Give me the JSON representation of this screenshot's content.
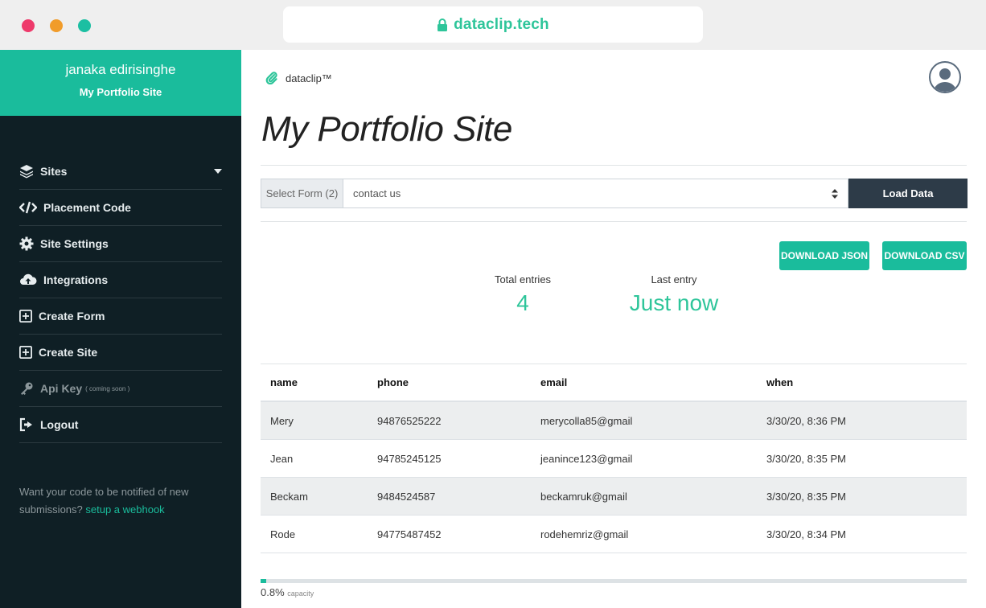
{
  "browser": {
    "url": "dataclip.tech"
  },
  "sidebar": {
    "user_name": "janaka edirisinghe",
    "site_name": "My Portfolio Site",
    "items": [
      {
        "label": "Sites",
        "icon": "layers-icon"
      },
      {
        "label": "Placement Code",
        "icon": "code-icon"
      },
      {
        "label": "Site Settings",
        "icon": "gear-icon"
      },
      {
        "label": "Integrations",
        "icon": "cloud-upload-icon"
      },
      {
        "label": "Create Form",
        "icon": "plus-square-icon"
      },
      {
        "label": "Create Site",
        "icon": "plus-square-icon"
      },
      {
        "label": "Api Key",
        "sub": "( coming soon )",
        "icon": "key-icon"
      },
      {
        "label": "Logout",
        "icon": "sign-out-icon"
      }
    ],
    "webhook_text": "Want your code to be notified of new submissions?",
    "webhook_link": "setup a webhook"
  },
  "main": {
    "brand": "dataclip™",
    "title": "My Portfolio Site",
    "form_label": "Select Form (2)",
    "form_selected": "contact us",
    "load_button": "Load Data",
    "download_json": "DOWNLOAD JSON",
    "download_csv": "DOWNLOAD CSV",
    "stats": {
      "total_label": "Total entries",
      "total_value": "4",
      "last_label": "Last entry",
      "last_value": "Just now"
    },
    "table": {
      "headers": [
        "name",
        "phone",
        "email",
        "when"
      ],
      "rows": [
        [
          "Mery",
          "94876525222",
          "merycolla85@gmail",
          "3/30/20, 8:36 PM"
        ],
        [
          "Jean",
          "94785245125",
          "jeanince123@gmail",
          "3/30/20, 8:35 PM"
        ],
        [
          "Beckam",
          "9484524587",
          "beckamruk@gmail",
          "3/30/20, 8:35 PM"
        ],
        [
          "Rode",
          "94775487452",
          "rodehemriz@gmail",
          "3/30/20, 8:34 PM"
        ]
      ]
    },
    "capacity": {
      "value": "0.8%",
      "label": "capacity",
      "fraction": 0.008
    }
  },
  "colors": {
    "accent": "#1abc9c",
    "sidebar_bg": "#0f1f25",
    "button_dark": "#2d3b48"
  }
}
